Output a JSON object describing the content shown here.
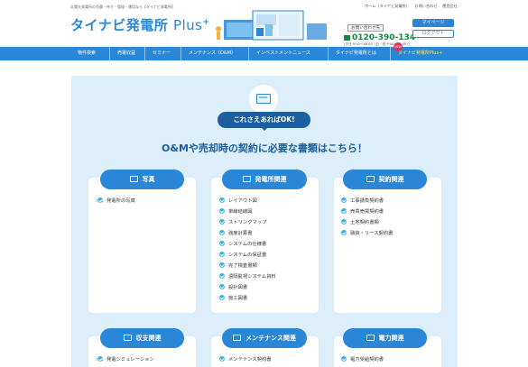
{
  "header": {
    "tagline": "太陽光発電所の売買・仲介・管理・運用なら【タイナビ発電所】",
    "logo_main": "タイナビ発電所",
    "logo_plus": "Plus",
    "logo_sup": "+",
    "top_links": [
      "ホーム（タイナビ発電所）",
      "お問い合わせ",
      "運営会社"
    ],
    "contact_label": "お問い合わせ先",
    "phone": "0120-390-134",
    "hours": "[平日 9:00〜18:00（日・祝 9:00〜17:00）]",
    "mypage": "マイページ",
    "logout": "ログアウト"
  },
  "nav": {
    "items": [
      "物件検索",
      "売電収益",
      "セミナー",
      "メンテナンス（O&M）",
      "インベストメントニュース",
      "タイナビ発電所とは",
      "タイナビ発電所Plus+"
    ],
    "new_badge": "NEW"
  },
  "intro": {
    "bubble": "これさえあればOK!",
    "subtitle": "O&Mや売却時の契約に必要な書類はこちら！"
  },
  "categories": [
    {
      "title": "写真",
      "items": [
        "発電所の写真"
      ]
    },
    {
      "title": "発電所関連",
      "items": [
        "レイアウト図",
        "単線結線図",
        "ストリングマップ",
        "強度計算書",
        "システムの仕様書",
        "システムの保証書",
        "完了検査書類",
        "遠隔監視システム資料",
        "設計図書",
        "施工図書"
      ]
    },
    {
      "title": "契約関連",
      "items": [
        "工事請負契約書",
        "売買売買契約書",
        "土地契約書類",
        "融資・リース契約書"
      ]
    },
    {
      "title": "収支関連",
      "items": [
        "発電シミュレーション"
      ]
    },
    {
      "title": "メンテナンス関連",
      "items": [
        "メンテナンス契約書"
      ]
    },
    {
      "title": "電力関連",
      "items": [
        "電力受給契約書"
      ]
    }
  ],
  "colors": {
    "brand": "#2a86d6",
    "dark": "#1b5f9e",
    "panel": "#dbeefa",
    "phone": "#0e8a3c",
    "check": "#3aaee0"
  }
}
